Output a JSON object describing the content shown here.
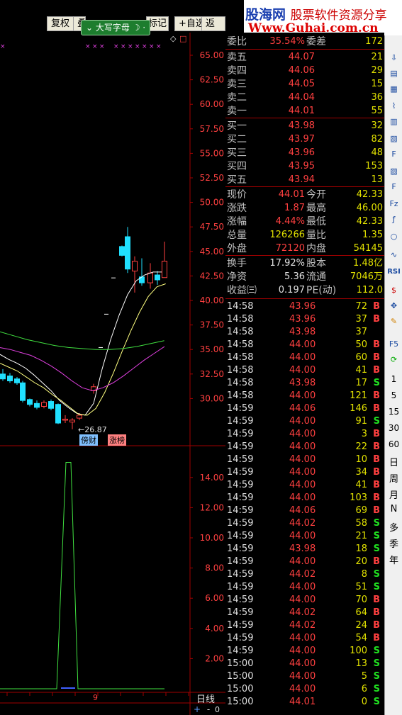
{
  "toolbar": {
    "buttons": [
      "复权",
      "叠",
      "标记",
      "+自选",
      "返回"
    ],
    "ime_label": "大写字母"
  },
  "banner": {
    "title_cn": "股海网",
    "title_sub": "股票软件资源分享",
    "url": "Www.Guhai.com.cn"
  },
  "chart": {
    "price_ticks": [
      "65.00",
      "62.50",
      "60.00",
      "57.50",
      "55.00",
      "52.50",
      "50.00",
      "47.50",
      "45.00",
      "42.50",
      "40.00",
      "37.50",
      "35.00",
      "32.50",
      "30.00"
    ],
    "volume_ticks": [
      "14.00",
      "12.00",
      "10.00",
      "8.00",
      "6.00",
      "4.00",
      "2.00"
    ],
    "low_label": "26.87",
    "badge_a": "傍财",
    "badge_b": "涨榜",
    "date_label": "9",
    "period_label": "日线",
    "zoom_in": "+",
    "zoom_out": "-",
    "zoom_val": "0"
  },
  "quote": {
    "weibi_label": "委比",
    "weibi_value": "35.54%",
    "weicha_label": "委差",
    "weicha_value": "172",
    "asks": [
      {
        "label": "卖五",
        "price": "44.07",
        "vol": "21"
      },
      {
        "label": "卖四",
        "price": "44.06",
        "vol": "29"
      },
      {
        "label": "卖三",
        "price": "44.05",
        "vol": "15"
      },
      {
        "label": "卖二",
        "price": "44.04",
        "vol": "36"
      },
      {
        "label": "卖一",
        "price": "44.01",
        "vol": "55"
      }
    ],
    "bids": [
      {
        "label": "买一",
        "price": "43.98",
        "vol": "32"
      },
      {
        "label": "买二",
        "price": "43.97",
        "vol": "82"
      },
      {
        "label": "买三",
        "price": "43.96",
        "vol": "48"
      },
      {
        "label": "买四",
        "price": "43.95",
        "vol": "153"
      },
      {
        "label": "买五",
        "price": "43.94",
        "vol": "13"
      }
    ],
    "stats": [
      {
        "l1": "现价",
        "v1": "44.01",
        "c1": "red",
        "l2": "今开",
        "v2": "42.33",
        "c2": "red"
      },
      {
        "l1": "涨跌",
        "v1": "1.87",
        "c1": "red",
        "l2": "最高",
        "v2": "46.00",
        "c2": "red"
      },
      {
        "l1": "涨幅",
        "v1": "4.44%",
        "c1": "red",
        "l2": "最低",
        "v2": "42.33",
        "c2": "red"
      },
      {
        "l1": "总量",
        "v1": "126266",
        "c1": "yel",
        "l2": "量比",
        "v2": "1.35",
        "c2": "red"
      },
      {
        "l1": "外盘",
        "v1": "72120",
        "c1": "red",
        "l2": "内盘",
        "v2": "54145",
        "c2": "grn"
      }
    ],
    "stats2": [
      {
        "l1": "换手",
        "v1": "17.92%",
        "l2": "股本",
        "v2": "1.48亿"
      },
      {
        "l1": "净资",
        "v1": "5.36",
        "l2": "流通",
        "v2": "7046万"
      },
      {
        "l1": "收益㈢",
        "v1": "0.197",
        "l2": "PE(动)",
        "v2": "112.0"
      }
    ]
  },
  "ticks": [
    {
      "t": "14:58",
      "p": "43.96",
      "pc": "red",
      "q": "72",
      "f": "B"
    },
    {
      "t": "14:58",
      "p": "43.96",
      "pc": "red",
      "q": "37",
      "f": "B"
    },
    {
      "t": "14:58",
      "p": "43.98",
      "pc": "red",
      "q": "37",
      "f": ""
    },
    {
      "t": "14:58",
      "p": "44.00",
      "pc": "red",
      "q": "50",
      "f": "B"
    },
    {
      "t": "14:58",
      "p": "44.00",
      "pc": "red",
      "q": "60",
      "f": "B"
    },
    {
      "t": "14:58",
      "p": "44.00",
      "pc": "red",
      "q": "41",
      "f": "B"
    },
    {
      "t": "14:58",
      "p": "43.98",
      "pc": "red",
      "q": "17",
      "f": "S"
    },
    {
      "t": "14:58",
      "p": "44.00",
      "pc": "red",
      "q": "121",
      "f": "B"
    },
    {
      "t": "14:59",
      "p": "44.06",
      "pc": "red",
      "q": "146",
      "f": "B"
    },
    {
      "t": "14:59",
      "p": "44.00",
      "pc": "red",
      "q": "91",
      "f": "S"
    },
    {
      "t": "14:59",
      "p": "44.00",
      "pc": "red",
      "q": "3",
      "f": "B"
    },
    {
      "t": "14:59",
      "p": "44.00",
      "pc": "red",
      "q": "22",
      "f": "B"
    },
    {
      "t": "14:59",
      "p": "44.00",
      "pc": "red",
      "q": "10",
      "f": "B"
    },
    {
      "t": "14:59",
      "p": "44.00",
      "pc": "red",
      "q": "34",
      "f": "B"
    },
    {
      "t": "14:59",
      "p": "44.00",
      "pc": "red",
      "q": "41",
      "f": "B"
    },
    {
      "t": "14:59",
      "p": "44.00",
      "pc": "red",
      "q": "103",
      "f": "B"
    },
    {
      "t": "14:59",
      "p": "44.06",
      "pc": "red",
      "q": "69",
      "f": "B"
    },
    {
      "t": "14:59",
      "p": "44.02",
      "pc": "red",
      "q": "58",
      "f": "S"
    },
    {
      "t": "14:59",
      "p": "44.00",
      "pc": "red",
      "q": "21",
      "f": "S"
    },
    {
      "t": "14:59",
      "p": "43.98",
      "pc": "red",
      "q": "18",
      "f": "S"
    },
    {
      "t": "14:59",
      "p": "44.00",
      "pc": "red",
      "q": "20",
      "f": "B"
    },
    {
      "t": "14:59",
      "p": "44.02",
      "pc": "red",
      "q": "8",
      "f": "S"
    },
    {
      "t": "14:59",
      "p": "44.00",
      "pc": "red",
      "q": "51",
      "f": "S"
    },
    {
      "t": "14:59",
      "p": "44.00",
      "pc": "red",
      "q": "70",
      "f": "B"
    },
    {
      "t": "14:59",
      "p": "44.02",
      "pc": "red",
      "q": "64",
      "f": "B"
    },
    {
      "t": "14:59",
      "p": "44.02",
      "pc": "red",
      "q": "24",
      "f": "B"
    },
    {
      "t": "14:59",
      "p": "44.00",
      "pc": "red",
      "q": "54",
      "f": "B"
    },
    {
      "t": "14:59",
      "p": "44.00",
      "pc": "red",
      "q": "100",
      "f": "S"
    },
    {
      "t": "15:00",
      "p": "44.00",
      "pc": "red",
      "q": "13",
      "f": "S"
    },
    {
      "t": "15:00",
      "p": "44.00",
      "pc": "red",
      "q": "5",
      "f": "S"
    },
    {
      "t": "15:00",
      "p": "44.00",
      "pc": "red",
      "q": "6",
      "f": "S"
    },
    {
      "t": "15:00",
      "p": "44.01",
      "pc": "red",
      "q": "0",
      "f": "S"
    }
  ],
  "sidebar": {
    "periods": [
      "1",
      "5",
      "15",
      "30",
      "60"
    ],
    "cycles": [
      "日",
      "周",
      "月",
      "N",
      "多",
      "季",
      "年"
    ],
    "rsi_label": "RSI"
  },
  "colors": {
    "up": "#ff4040",
    "down": "#20e0ff",
    "grid": "#a00000",
    "ma_white": "#ffffff",
    "ma_yellow": "#ffff80",
    "ma_purple": "#e040e0",
    "ma_green": "#40e040"
  },
  "chart_data": {
    "type": "candlestick",
    "price_axis": {
      "min": 27.5,
      "max": 65.0,
      "ticks": [
        30,
        32.5,
        35,
        37.5,
        40,
        42.5,
        45,
        47.5,
        50,
        52.5,
        55,
        57.5,
        60,
        62.5,
        65
      ]
    },
    "candles": [
      {
        "o": 32.5,
        "c": 32.0,
        "h": 33.0,
        "l": 31.8
      },
      {
        "o": 32.3,
        "c": 31.8,
        "h": 32.6,
        "l": 31.6
      },
      {
        "o": 32.0,
        "c": 31.6,
        "h": 32.2,
        "l": 31.4
      },
      {
        "o": 31.6,
        "c": 29.8,
        "h": 31.8,
        "l": 29.6
      },
      {
        "o": 29.9,
        "c": 29.4,
        "h": 30.0,
        "l": 29.2
      },
      {
        "o": 29.5,
        "c": 29.1,
        "h": 29.8,
        "l": 28.9
      },
      {
        "o": 29.2,
        "c": 29.6,
        "h": 29.8,
        "l": 29.0
      },
      {
        "o": 29.7,
        "c": 29.0,
        "h": 29.9,
        "l": 28.8
      },
      {
        "o": 29.4,
        "c": 27.5,
        "h": 29.5,
        "l": 27.4
      },
      {
        "o": 27.8,
        "c": 27.9,
        "h": 28.3,
        "l": 27.5
      },
      {
        "o": 27.6,
        "c": 27.8,
        "h": 28.0,
        "l": 26.87
      },
      {
        "o": 28.0,
        "c": 28.3,
        "h": 28.5,
        "l": 27.8
      },
      {
        "o": 30.8,
        "c": 31.2,
        "h": 31.5,
        "l": 30.5
      },
      {
        "o": 45.5,
        "c": 44.6,
        "h": 45.6,
        "l": 44.5
      },
      {
        "o": 46.5,
        "c": 43.2,
        "h": 47.5,
        "l": 42.8
      },
      {
        "o": 43.0,
        "c": 44.0,
        "h": 44.5,
        "l": 40.8
      },
      {
        "o": 42.4,
        "c": 41.8,
        "h": 44.3,
        "l": 41.5
      },
      {
        "o": 41.8,
        "c": 42.8,
        "h": 43.8,
        "l": 41.2
      },
      {
        "o": 42.6,
        "c": 42.1,
        "h": 43.0,
        "l": 41.6
      },
      {
        "o": 42.33,
        "c": 44.01,
        "h": 46.0,
        "l": 42.33
      }
    ],
    "volume_axis": {
      "min": 0,
      "max": 15,
      "ticks": [
        2,
        4,
        6,
        8,
        10,
        12,
        14
      ]
    },
    "volume_spike": {
      "peak": 15.0
    }
  }
}
